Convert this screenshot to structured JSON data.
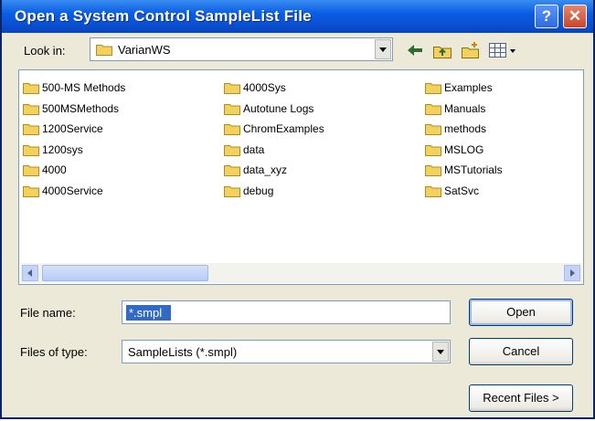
{
  "window": {
    "title": "Open a System Control SampleList File",
    "help_label": "?",
    "close_label": "✕"
  },
  "look_in": {
    "label": "Look in:",
    "value": "VarianWS"
  },
  "toolbar": {
    "icons": [
      "back-icon",
      "up-folder-icon",
      "new-folder-icon",
      "view-menu-icon"
    ]
  },
  "files": {
    "items": [
      {
        "name": "500-MS Methods",
        "icon": "folder-icon"
      },
      {
        "name": "500MSMethods",
        "icon": "folder-icon"
      },
      {
        "name": "1200Service",
        "icon": "folder-icon"
      },
      {
        "name": "1200sys",
        "icon": "folder-icon"
      },
      {
        "name": "4000",
        "icon": "folder-icon"
      },
      {
        "name": "4000Service",
        "icon": "folder-icon"
      },
      {
        "name": "4000Sys",
        "icon": "folder-icon"
      },
      {
        "name": "Autotune Logs",
        "icon": "folder-icon"
      },
      {
        "name": "ChromExamples",
        "icon": "folder-icon"
      },
      {
        "name": "data",
        "icon": "folder-icon"
      },
      {
        "name": "data_xyz",
        "icon": "folder-icon"
      },
      {
        "name": "debug",
        "icon": "folder-icon"
      },
      {
        "name": "Examples",
        "icon": "folder-icon"
      },
      {
        "name": "Manuals",
        "icon": "folder-icon"
      },
      {
        "name": "methods",
        "icon": "folder-icon"
      },
      {
        "name": "MSLOG",
        "icon": "folder-icon"
      },
      {
        "name": "MSTutorials",
        "icon": "folder-icon"
      },
      {
        "name": "SatSvc",
        "icon": "folder-icon"
      }
    ]
  },
  "file_name": {
    "label": "File name:",
    "value": "*.smpl"
  },
  "file_type": {
    "label": "Files of type:",
    "value": "SampleLists (*.smpl)"
  },
  "buttons": {
    "open": "Open",
    "cancel": "Cancel",
    "recent": "Recent Files >"
  },
  "colors": {
    "title_bar": "#0a52d6",
    "dialog_bg": "#ece9d8",
    "folder": "#f2d25c",
    "selection": "#316ac5"
  }
}
